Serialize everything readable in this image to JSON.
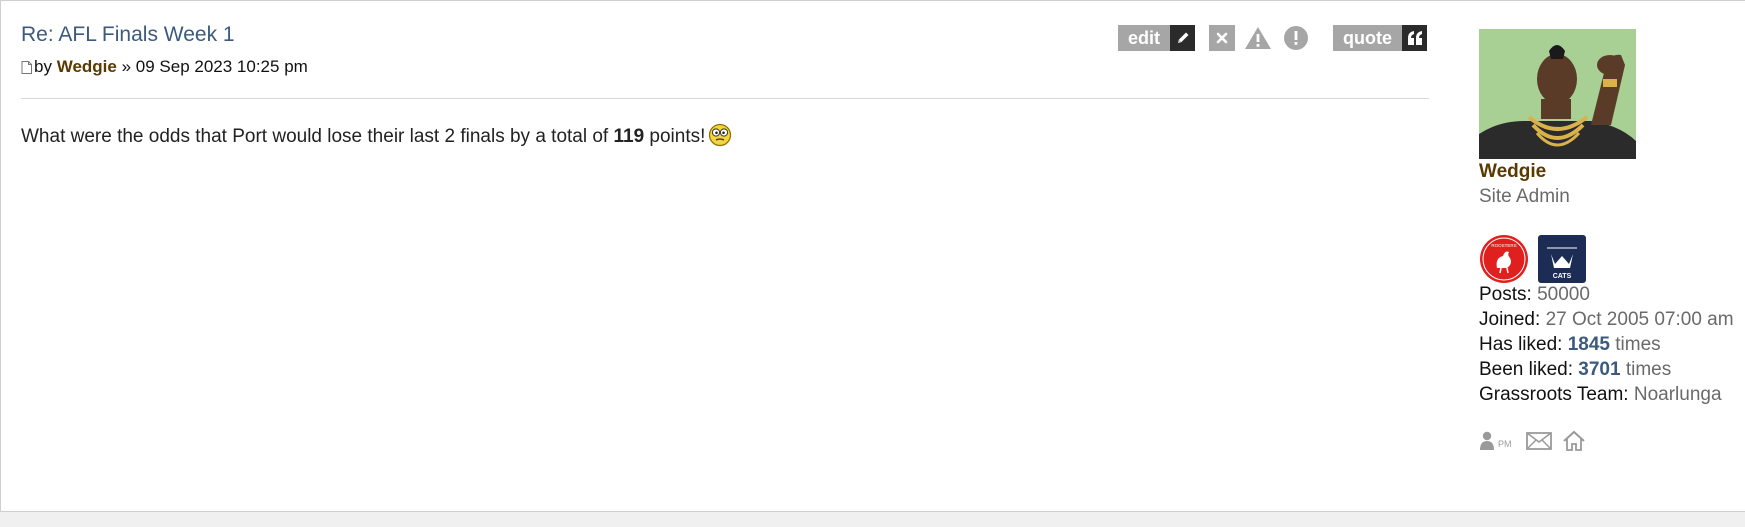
{
  "post": {
    "title": "Re: AFL Finals Week 1",
    "by_label": "by",
    "author": "Wedgie",
    "separator": "»",
    "datetime": "09 Sep 2023 10:25 pm",
    "content_before": "What were the odds that Port would lose their last 2 finals by a total of ",
    "content_bold": "119",
    "content_after": " points!",
    "smiley_icon": "shock-smiley-icon"
  },
  "buttons": {
    "edit_label": "edit",
    "quote_label": "quote",
    "icons": [
      "pencil-icon",
      "close-icon",
      "warning-icon",
      "exclamation-icon",
      "quote-icon"
    ]
  },
  "profile": {
    "username": "Wedgie",
    "rank": "Site Admin",
    "badges": [
      "roosters-badge",
      "cats-badge"
    ],
    "badge_texts": [
      "ROOSTERS",
      "CATS"
    ],
    "posts_label": "Posts:",
    "posts_value": "50000",
    "joined_label": "Joined:",
    "joined_value": "27 Oct 2005 07:00 am",
    "has_liked_label": "Has liked:",
    "has_liked_value": "1845",
    "has_liked_suffix": "times",
    "been_liked_label": "Been liked:",
    "been_liked_value": "3701",
    "been_liked_suffix": "times",
    "team_label": "Grassroots Team:",
    "team_value": "Noarlunga",
    "contact_pm_label": "PM",
    "contact_icons": [
      "pm-icon",
      "email-icon",
      "home-icon"
    ]
  },
  "colors": {
    "title_link": "#3b5a7e",
    "username": "#5a3a00",
    "button_grey": "#a6a6a6",
    "button_dark": "#2b2b2b",
    "muted": "#6a6a6a"
  }
}
